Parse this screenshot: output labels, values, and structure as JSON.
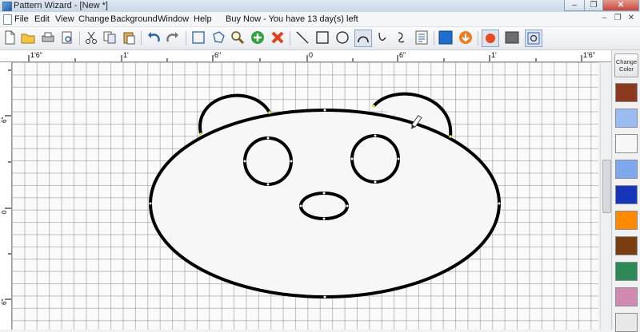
{
  "window": {
    "title": "Pattern Wizard - [New *]",
    "buttons": {
      "minimize": "–",
      "maximize": "❐",
      "close": "✕"
    }
  },
  "menubar": {
    "items": [
      "File",
      "Edit",
      "View",
      "Change",
      "Background",
      "Window",
      "Help"
    ],
    "buy_now": "Buy Now - You have 13 day(s) left",
    "mdi_controls": [
      "–",
      "❐",
      "✕"
    ]
  },
  "toolbar": {
    "tools": [
      "new-file-icon",
      "open-folder-icon",
      "print-icon",
      "print-preview-icon",
      "cut-icon",
      "copy-icon",
      "paste-icon",
      "undo-icon",
      "redo-icon",
      "rect-select-icon",
      "lasso-select-icon",
      "zoom-icon",
      "add-icon",
      "delete-icon",
      "line-tool-icon",
      "rectangle-tool-icon",
      "circle-tool-icon",
      "arc-tool-icon",
      "curve-tool-icon",
      "freehand-tool-icon",
      "text-tool-icon",
      "fill-color-icon",
      "down-arrow-icon",
      "record-icon",
      "grayscale-icon",
      "fit-view-icon"
    ]
  },
  "rulers": {
    "horizontal": [
      "1'6\"",
      "1'",
      "6\"",
      "0",
      "6\"",
      "1'",
      "1'6\""
    ],
    "vertical": [
      "6\"",
      "0",
      "6\""
    ]
  },
  "palette": {
    "change_color_label": "Change Color",
    "swatches": [
      "#8b3a1e",
      "#9bbcf2",
      "#f7f7f7",
      "#7ea8ee",
      "#1635b8",
      "#ff8a00",
      "#7a3d10",
      "#2e8a55",
      "#d089b0",
      "#e8e8e8"
    ]
  },
  "colors": {
    "outline": "#000000",
    "fill": "#f7f7f7",
    "grid": "#8a8a8a"
  }
}
